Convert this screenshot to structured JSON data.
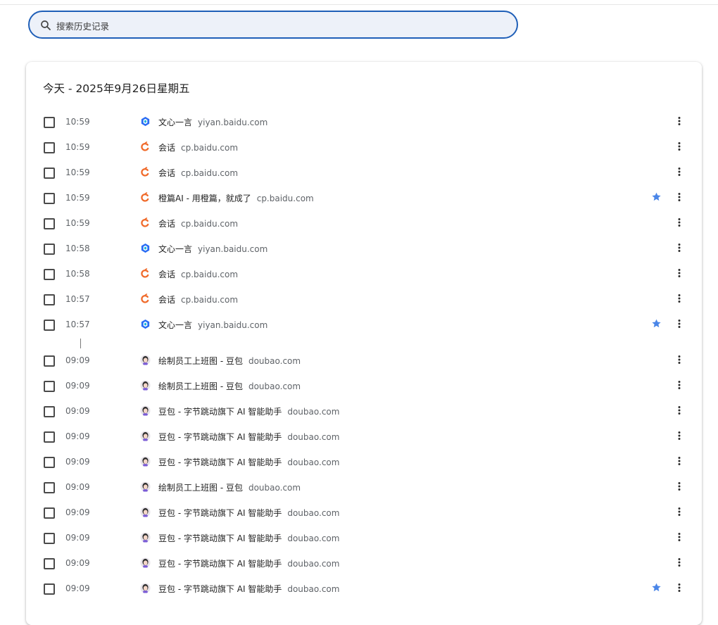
{
  "search": {
    "placeholder": "搜索历史记录"
  },
  "day": {
    "title": "今天 - 2025年9月26日星期五"
  },
  "colors": {
    "accent": "#1f5fb8",
    "star": "#4a86e8"
  },
  "entries": [
    {
      "time": "10:59",
      "title": "文心一言",
      "domain": "yiyan.baidu.com",
      "icon": "wenxin-icon",
      "starred": false
    },
    {
      "time": "10:59",
      "title": "会话",
      "domain": "cp.baidu.com",
      "icon": "chengpian-icon",
      "starred": false
    },
    {
      "time": "10:59",
      "title": "会话",
      "domain": "cp.baidu.com",
      "icon": "chengpian-icon",
      "starred": false
    },
    {
      "time": "10:59",
      "title": "橙篇AI - 用橙篇，就成了",
      "domain": "cp.baidu.com",
      "icon": "chengpian-icon",
      "starred": true
    },
    {
      "time": "10:59",
      "title": "会话",
      "domain": "cp.baidu.com",
      "icon": "chengpian-icon",
      "starred": false
    },
    {
      "time": "10:58",
      "title": "文心一言",
      "domain": "yiyan.baidu.com",
      "icon": "wenxin-icon",
      "starred": false
    },
    {
      "time": "10:58",
      "title": "会话",
      "domain": "cp.baidu.com",
      "icon": "chengpian-icon",
      "starred": false
    },
    {
      "time": "10:57",
      "title": "会话",
      "domain": "cp.baidu.com",
      "icon": "chengpian-icon",
      "starred": false
    },
    {
      "time": "10:57",
      "title": "文心一言",
      "domain": "yiyan.baidu.com",
      "icon": "wenxin-icon",
      "starred": true
    },
    {
      "time": "09:09",
      "title": "绘制员工上班图 - 豆包",
      "domain": "doubao.com",
      "icon": "doubao-icon",
      "starred": false
    },
    {
      "time": "09:09",
      "title": "绘制员工上班图 - 豆包",
      "domain": "doubao.com",
      "icon": "doubao-icon",
      "starred": false
    },
    {
      "time": "09:09",
      "title": "豆包 - 字节跳动旗下 AI 智能助手",
      "domain": "doubao.com",
      "icon": "doubao-icon",
      "starred": false
    },
    {
      "time": "09:09",
      "title": "豆包 - 字节跳动旗下 AI 智能助手",
      "domain": "doubao.com",
      "icon": "doubao-icon",
      "starred": false
    },
    {
      "time": "09:09",
      "title": "豆包 - 字节跳动旗下 AI 智能助手",
      "domain": "doubao.com",
      "icon": "doubao-icon",
      "starred": false
    },
    {
      "time": "09:09",
      "title": "绘制员工上班图 - 豆包",
      "domain": "doubao.com",
      "icon": "doubao-icon",
      "starred": false
    },
    {
      "time": "09:09",
      "title": "豆包 - 字节跳动旗下 AI 智能助手",
      "domain": "doubao.com",
      "icon": "doubao-icon",
      "starred": false
    },
    {
      "time": "09:09",
      "title": "豆包 - 字节跳动旗下 AI 智能助手",
      "domain": "doubao.com",
      "icon": "doubao-icon",
      "starred": false
    },
    {
      "time": "09:09",
      "title": "豆包 - 字节跳动旗下 AI 智能助手",
      "domain": "doubao.com",
      "icon": "doubao-icon",
      "starred": false
    },
    {
      "time": "09:09",
      "title": "豆包 - 字节跳动旗下 AI 智能助手",
      "domain": "doubao.com",
      "icon": "doubao-icon",
      "starred": true
    }
  ]
}
